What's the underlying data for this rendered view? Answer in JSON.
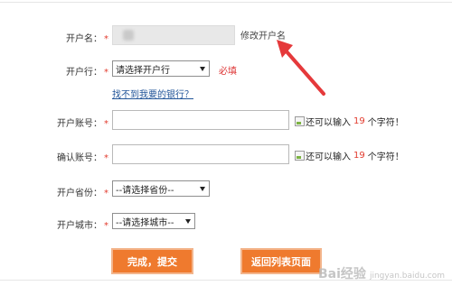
{
  "form": {
    "account_name": {
      "label": "开户名：",
      "required": "*"
    },
    "bank": {
      "label": "开户行：",
      "required": "*",
      "selected": "请选择开户行",
      "required_note": "必填",
      "help_link": "找不到我要的银行？"
    },
    "account_number": {
      "label": "开户账号：",
      "required": "*",
      "hint_prefix": "还可以输入",
      "hint_count": "19",
      "hint_suffix": "个字符！"
    },
    "confirm_number": {
      "label": "确认账号：",
      "required": "*",
      "hint_prefix": "还可以输入",
      "hint_count": "19",
      "hint_suffix": "个字符！"
    },
    "province": {
      "label": "开户省份：",
      "required": "*",
      "selected": "--请选择省份--"
    },
    "city": {
      "label": "开户城市：",
      "required": "*",
      "selected": "--请选择城市--"
    }
  },
  "annotation": {
    "text": "修改开户名"
  },
  "buttons": {
    "submit": "完成，提交",
    "back": "返回列表页面"
  },
  "watermark": {
    "text": "Bai经验",
    "sub": "jingyan.baidu.com"
  },
  "colors": {
    "accent_button": "#ef7a2e",
    "required": "#e23b2e",
    "arrow": "#e5393b",
    "link": "#225599"
  }
}
